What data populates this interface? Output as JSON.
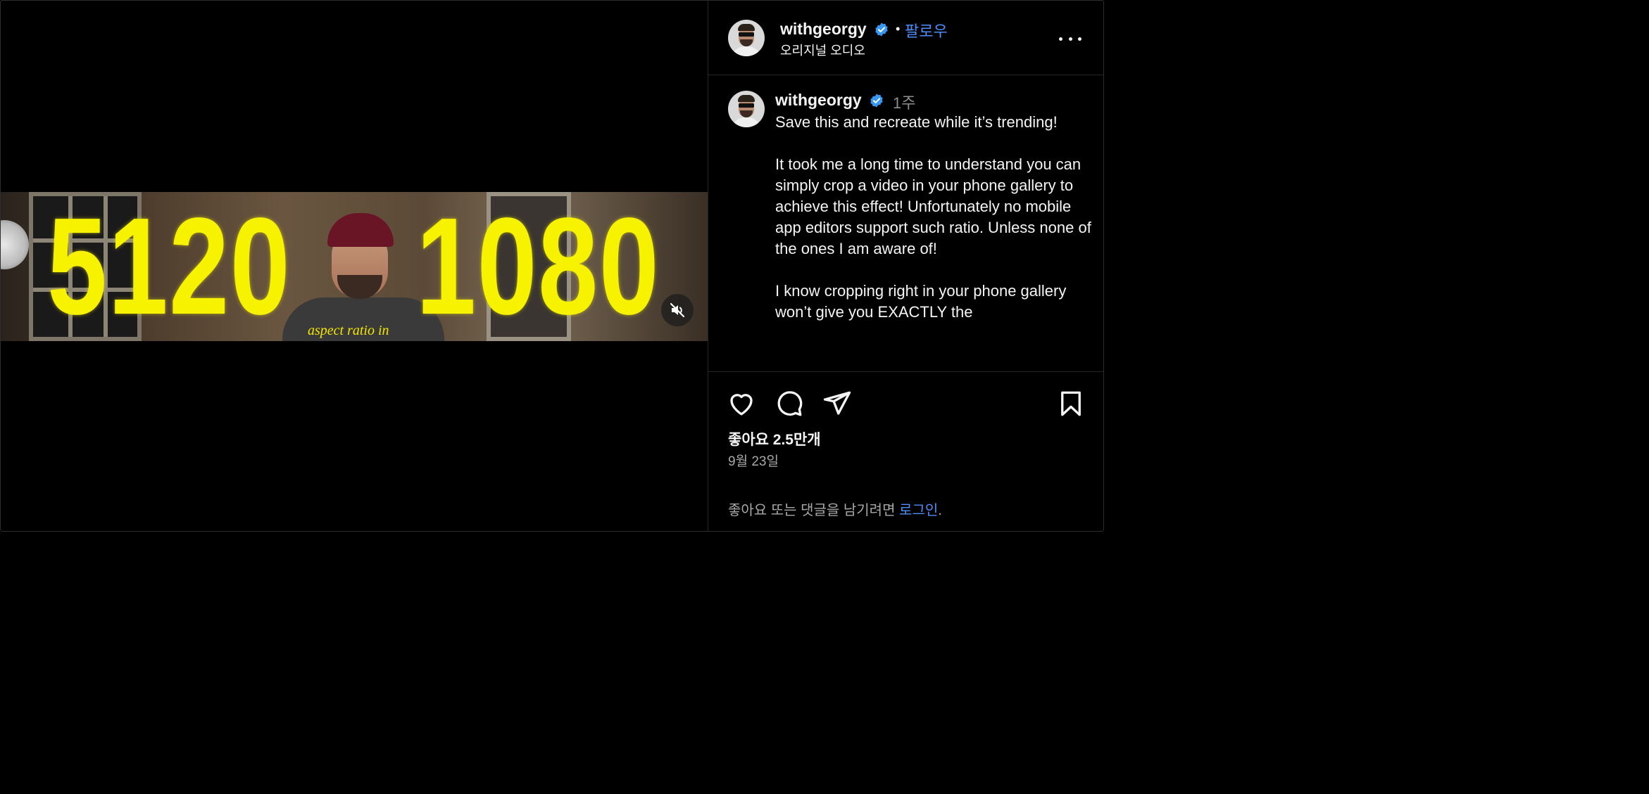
{
  "video": {
    "overlay_left": "5120",
    "overlay_right": "1080",
    "subtitle": "aspect ratio in",
    "mute_icon": "speaker-muted-icon"
  },
  "header": {
    "username": "withgeorgy",
    "verified_icon": "verified-badge-icon",
    "separator": "•",
    "follow_label": "팔로우",
    "audio_label": "오리지널 오디오",
    "more_icon": "more-options-icon"
  },
  "post": {
    "username": "withgeorgy",
    "time_ago": "1주",
    "caption": "Save this and recreate while it’s trending!\n\nIt took me a long time to understand you can simply crop a video in your phone gallery to achieve this effect! Unfortunately no mobile app editors support such ratio. Unless none of the ones I am aware of!\n\nI know cropping right in your phone gallery won’t give you EXACTLY the"
  },
  "actions": {
    "like_icon": "heart-icon",
    "comment_icon": "comment-icon",
    "share_icon": "send-icon",
    "save_icon": "bookmark-icon",
    "likes_text": "좋아요 2.5만개",
    "date_text": "9월 23일",
    "login_prompt": "좋아요 또는 댓글을 남기려면",
    "login_link": "로그인",
    "login_suffix": "."
  },
  "colors": {
    "background": "#000000",
    "accent_blue": "#4f8cf7",
    "verified_blue": "#3897f0",
    "overlay_yellow": "#f7f200",
    "muted_text": "#a8a8a8"
  }
}
